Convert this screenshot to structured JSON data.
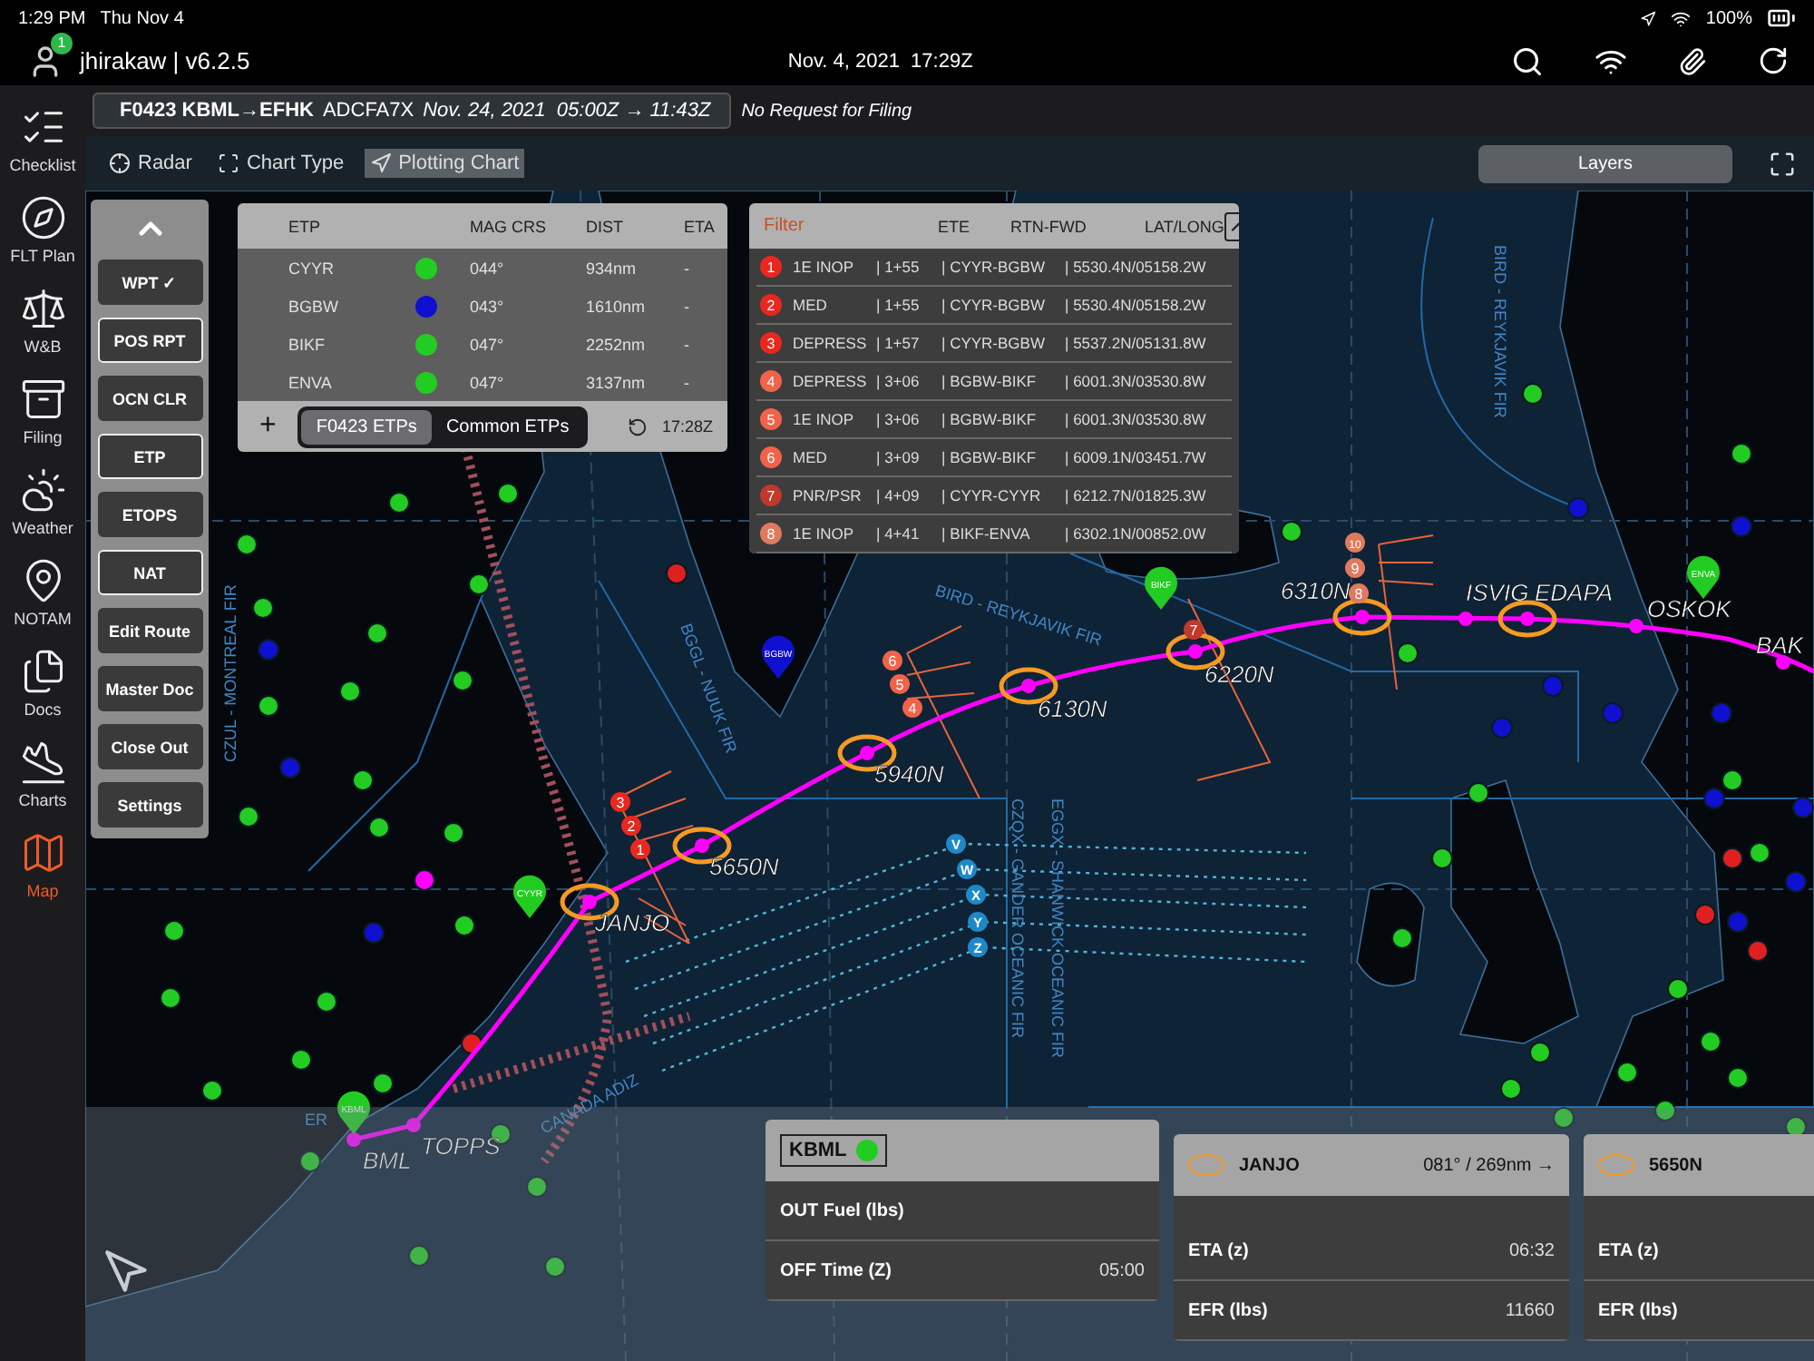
{
  "status_bar": {
    "time": "1:29 PM",
    "date": "Thu Nov 4",
    "battery": "100%"
  },
  "header": {
    "user": "jhirakaw | v6.2.5",
    "badge": "1",
    "datetime": "Nov. 4, 2021  17:29Z"
  },
  "sidebar": {
    "items": [
      {
        "label": "Checklist",
        "selected": false
      },
      {
        "label": "FLT Plan",
        "selected": false
      },
      {
        "label": "W&B",
        "selected": false
      },
      {
        "label": "Filing",
        "selected": false
      },
      {
        "label": "Weather",
        "selected": false
      },
      {
        "label": "NOTAM",
        "selected": false
      },
      {
        "label": "Docs",
        "selected": false
      },
      {
        "label": "Charts",
        "selected": false
      },
      {
        "label": "Map",
        "selected": true
      }
    ]
  },
  "flight_bar": {
    "flight": "F0423 KBML→EFHK",
    "aircraft": "ADCFA7X",
    "schedule": "Nov. 24, 2021  05:00Z → 11:43Z",
    "filing_status": "No Request for Filing"
  },
  "toolbar": {
    "items": [
      {
        "label": "Radar",
        "selected": false
      },
      {
        "label": "Chart Type",
        "selected": false
      },
      {
        "label": "Plotting Chart",
        "selected": true
      }
    ],
    "layers": "Layers"
  },
  "menu": {
    "buttons": [
      {
        "label": "WPT ✓",
        "on": false
      },
      {
        "label": "POS RPT",
        "on": true
      },
      {
        "label": "OCN CLR",
        "on": false
      },
      {
        "label": "ETP",
        "on": true
      },
      {
        "label": "ETOPS",
        "on": false
      },
      {
        "label": "NAT",
        "on": true
      },
      {
        "label": "Edit Route",
        "on": false
      },
      {
        "label": "Master Doc",
        "on": false
      },
      {
        "label": "Close Out",
        "on": false
      },
      {
        "label": "Settings",
        "on": false
      }
    ]
  },
  "etp_table": {
    "columns": [
      "ETP",
      "MAG CRS",
      "DIST",
      "ETA"
    ],
    "rows": [
      {
        "etp": "CYYR",
        "color": "#22cc22",
        "mag_crs": "044°",
        "dist": "934nm",
        "eta": "-"
      },
      {
        "etp": "BGBW",
        "color": "#1010d0",
        "mag_crs": "043°",
        "dist": "1610nm",
        "eta": "-"
      },
      {
        "etp": "BIKF",
        "color": "#22cc22",
        "mag_crs": "047°",
        "dist": "2252nm",
        "eta": "-"
      },
      {
        "etp": "ENVA",
        "color": "#22cc22",
        "mag_crs": "047°",
        "dist": "3137nm",
        "eta": "-"
      }
    ],
    "segments": [
      {
        "label": "F0423 ETPs",
        "selected": true
      },
      {
        "label": "Common ETPs",
        "selected": false
      }
    ],
    "add": "+",
    "refresh_time": "17:28Z"
  },
  "filter_table": {
    "title": "Filter",
    "columns": [
      "ETE",
      "RTN-FWD",
      "LAT/LONG"
    ],
    "rows": [
      {
        "number": "1",
        "color": "#e8281e",
        "type": "1E INOP",
        "ete": "| 1+55",
        "rtn_fwd": "| CYYR-BGBW",
        "lat_long": "| 5530.4N/05158.2W"
      },
      {
        "number": "2",
        "color": "#e8281e",
        "type": "MED",
        "ete": "| 1+55",
        "rtn_fwd": "| CYYR-BGBW",
        "lat_long": "| 5530.4N/05158.2W"
      },
      {
        "number": "3",
        "color": "#e8281e",
        "type": "DEPRESS",
        "ete": "| 1+57",
        "rtn_fwd": "| CYYR-BGBW",
        "lat_long": "| 5537.2N/05131.8W"
      },
      {
        "number": "4",
        "color": "#f0634a",
        "type": "DEPRESS",
        "ete": "| 3+06",
        "rtn_fwd": "| BGBW-BIKF",
        "lat_long": "| 6001.3N/03530.8W"
      },
      {
        "number": "5",
        "color": "#f0634a",
        "type": "1E INOP",
        "ete": "| 3+06",
        "rtn_fwd": "| BGBW-BIKF",
        "lat_long": "| 6001.3N/03530.8W"
      },
      {
        "number": "6",
        "color": "#f0634a",
        "type": "MED",
        "ete": "| 3+09",
        "rtn_fwd": "| BGBW-BIKF",
        "lat_long": "| 6009.1N/03451.7W"
      },
      {
        "number": "7",
        "color": "#c0392b",
        "type": "PNR/PSR",
        "ete": "| 4+09",
        "rtn_fwd": "| CYYR-CYYR",
        "lat_long": "| 6212.7N/01825.3W"
      },
      {
        "number": "8",
        "color": "#e07a5f",
        "type": "1E INOP",
        "ete": "| 4+41",
        "rtn_fwd": "| BIKF-ENVA",
        "lat_long": "| 6302.1N/00852.0W"
      }
    ]
  },
  "map": {
    "labels": [
      "BIRD - REYKJAVIK FIR",
      "BGGL - NUUK FIR",
      "CZQX - GANDER OCEANIC FIR",
      "EGGX - SHANWICK OCEANIC FIR",
      "CANADA ADIZ",
      "ER",
      "BIRD - REYKJAVIK FIR",
      "CZUL - MONTREAL FIR"
    ],
    "waypoints": [
      {
        "label": "BML",
        "circled": false
      },
      {
        "label": "TOPPS",
        "circled": false
      },
      {
        "label": "JANJO",
        "circled": true
      },
      {
        "label": "5650N",
        "circled": true
      },
      {
        "label": "5940N",
        "circled": true
      },
      {
        "label": "6130N",
        "circled": true
      },
      {
        "label": "6220N",
        "circled": true
      },
      {
        "label": "6310N",
        "circled": true
      },
      {
        "label": "ISVIG",
        "circled": false
      },
      {
        "label": "EDAPA",
        "circled": true
      },
      {
        "label": "OSKOK",
        "circled": false
      },
      {
        "label": "BAK",
        "circled": false
      }
    ],
    "tracks": [
      "V",
      "W",
      "X",
      "Y",
      "Z"
    ],
    "etp_markers": [
      {
        "number": "3",
        "color": "#e8281e"
      },
      {
        "number": "2",
        "color": "#e8281e"
      },
      {
        "number": "1",
        "color": "#e8281e"
      },
      {
        "number": "6",
        "color": "#f0634a"
      },
      {
        "number": "5",
        "color": "#f0634a"
      },
      {
        "number": "4",
        "color": "#f0634a"
      },
      {
        "number": "7",
        "color": "#c0392b"
      },
      {
        "number": "10",
        "color": "#e07a5f"
      },
      {
        "number": "9",
        "color": "#e07a5f"
      },
      {
        "number": "8",
        "color": "#e07a5f"
      }
    ],
    "airports": [
      {
        "code": "BGBW",
        "color": "#1010d0"
      },
      {
        "code": "BIKF",
        "color": "#22cc22"
      },
      {
        "code": "ENVA",
        "color": "#22cc22"
      },
      {
        "code": "CYYR",
        "color": "#22cc22"
      },
      {
        "code": "KBML",
        "color": "#22cc22"
      }
    ]
  },
  "cards": {
    "departure": {
      "code": "KBML",
      "color": "#22cc22",
      "rows": [
        {
          "label": "OUT Fuel (lbs)"
        },
        {
          "label": "OFF Time (Z)",
          "value": "05:00"
        }
      ]
    },
    "waypoints": [
      {
        "name": "JANJO",
        "course": "081° / 269nm →",
        "rows": [
          {
            "label": "ETA (z)",
            "value": "06:32"
          },
          {
            "label": "EFR (lbs)",
            "value": "11660"
          }
        ]
      },
      {
        "name": "5650N",
        "rows": [
          {
            "label": "ETA (z)"
          },
          {
            "label": "EFR (lbs)"
          }
        ]
      }
    ]
  }
}
